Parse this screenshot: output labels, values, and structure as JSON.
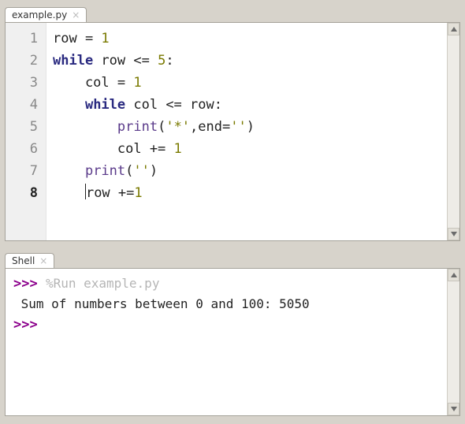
{
  "editor": {
    "tab_label": "example.py",
    "current_line": 8,
    "lines": [
      {
        "n": 1,
        "tokens": [
          [
            "",
            "row = "
          ],
          [
            "num",
            "1"
          ]
        ]
      },
      {
        "n": 2,
        "tokens": [
          [
            "kw",
            "while"
          ],
          [
            "",
            " row <= "
          ],
          [
            "num",
            "5"
          ],
          [
            "",
            ":"
          ]
        ]
      },
      {
        "n": 3,
        "tokens": [
          [
            "",
            "    col = "
          ],
          [
            "num",
            "1"
          ]
        ]
      },
      {
        "n": 4,
        "tokens": [
          [
            "",
            "    "
          ],
          [
            "kw",
            "while"
          ],
          [
            "",
            " col <= row:"
          ]
        ]
      },
      {
        "n": 5,
        "tokens": [
          [
            "",
            "        "
          ],
          [
            "fn",
            "print"
          ],
          [
            "",
            "("
          ],
          [
            "str",
            "'*'"
          ],
          [
            "",
            ",end="
          ],
          [
            "str",
            "''"
          ],
          [
            "",
            ")"
          ]
        ]
      },
      {
        "n": 6,
        "tokens": [
          [
            "",
            "        col += "
          ],
          [
            "num",
            "1"
          ]
        ]
      },
      {
        "n": 7,
        "tokens": [
          [
            "",
            "    "
          ],
          [
            "fn",
            "print"
          ],
          [
            "",
            "("
          ],
          [
            "str",
            "''"
          ],
          [
            "",
            ")"
          ]
        ]
      },
      {
        "n": 8,
        "tokens": [
          [
            "",
            "    row +="
          ],
          [
            "num",
            "1"
          ]
        ]
      }
    ]
  },
  "shell": {
    "tab_label": "Shell",
    "prompt": ">>>",
    "lines": [
      {
        "kind": "cmd",
        "text": "%Run example.py"
      },
      {
        "kind": "out",
        "text": " Sum of numbers between 0 and 100: 5050"
      },
      {
        "kind": "prompt",
        "text": ""
      }
    ]
  }
}
